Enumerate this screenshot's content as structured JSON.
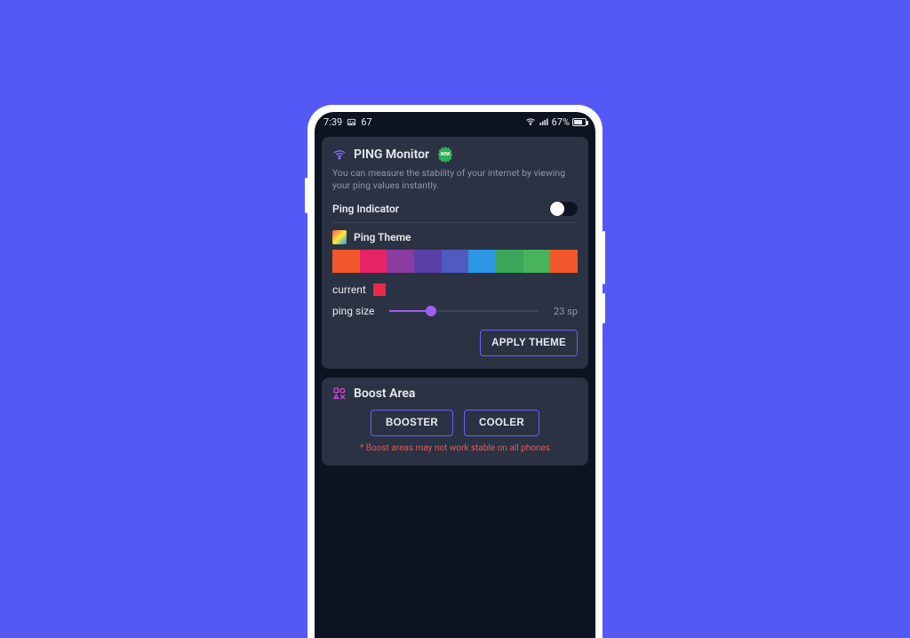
{
  "statusbar": {
    "time": "7:39",
    "nval": "67",
    "battery_pct": "67%"
  },
  "ping": {
    "title": "PING Monitor",
    "badge_text": "NEW",
    "desc": "You can measure the stability of your internet by viewing your ping values instantly.",
    "indicator_label": "Ping Indicator",
    "indicator_on": false,
    "theme_label": "Ping Theme",
    "palette": [
      "#f2572b",
      "#e72367",
      "#8c3ba0",
      "#5b3fa8",
      "#4f5bbf",
      "#2d97e5",
      "#3aa65a",
      "#48b35b",
      "#f2572b"
    ],
    "current_label": "current",
    "current_color": "#eb2a4a",
    "size_label": "ping size",
    "size_value": "23 sp",
    "apply_label": "APPLY THEME"
  },
  "boost": {
    "title": "Boost Area",
    "booster_label": "BOOSTER",
    "cooler_label": "COOLER",
    "note": "* Boost areas may not work stable on all phones"
  }
}
